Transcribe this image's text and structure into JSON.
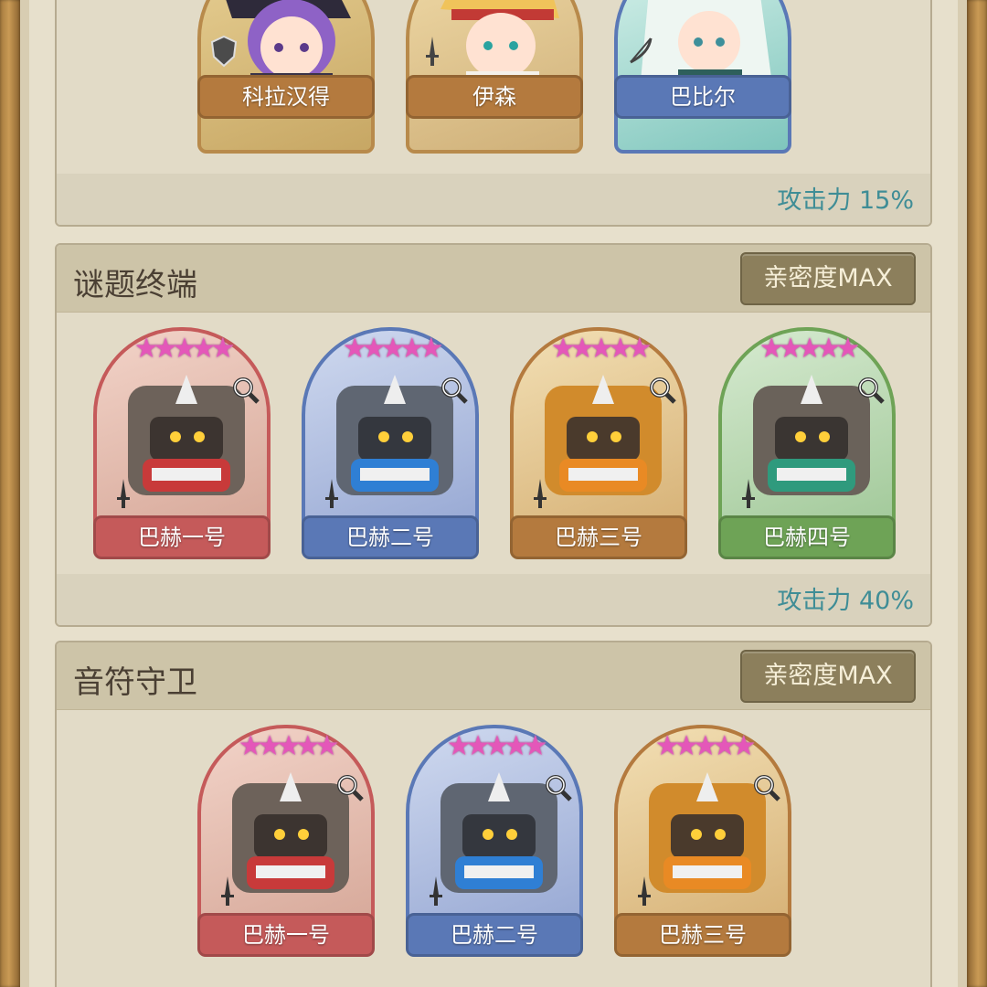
{
  "colors": {
    "red": "#c55a5a",
    "blue": "#5a78b6",
    "orange": "#b47a3e",
    "green": "#6ea356",
    "bonus_text": "#3f8d96"
  },
  "sections": [
    {
      "title": "",
      "affinity": "",
      "bonus": "攻击力 15%",
      "cards": [
        {
          "name": "科拉汉得",
          "color": "orange",
          "class_icon": "shield-icon"
        },
        {
          "name": "伊森",
          "color": "orange",
          "class_icon": "sword-icon"
        },
        {
          "name": "巴比尔",
          "color": "blue",
          "class_icon": "bow-icon"
        }
      ]
    },
    {
      "title": "谜题终端",
      "affinity": "亲密度MAX",
      "bonus": "攻击力 40%",
      "cards": [
        {
          "name": "巴赫一号",
          "color": "red",
          "stars": "★★★★★",
          "class_icon": "sword-icon"
        },
        {
          "name": "巴赫二号",
          "color": "blue",
          "stars": "★★★★★",
          "class_icon": "sword-icon"
        },
        {
          "name": "巴赫三号",
          "color": "orange",
          "stars": "★★★★★",
          "class_icon": "sword-icon"
        },
        {
          "name": "巴赫四号",
          "color": "green",
          "stars": "★★★★★",
          "class_icon": "sword-icon"
        }
      ]
    },
    {
      "title": "音符守卫",
      "affinity": "亲密度MAX",
      "bonus": "",
      "cards": [
        {
          "name": "巴赫一号",
          "color": "red",
          "stars": "★★★★★",
          "class_icon": "sword-icon"
        },
        {
          "name": "巴赫二号",
          "color": "blue",
          "stars": "★★★★★",
          "class_icon": "sword-icon"
        },
        {
          "name": "巴赫三号",
          "color": "orange",
          "stars": "★★★★★",
          "class_icon": "sword-icon"
        }
      ]
    }
  ]
}
